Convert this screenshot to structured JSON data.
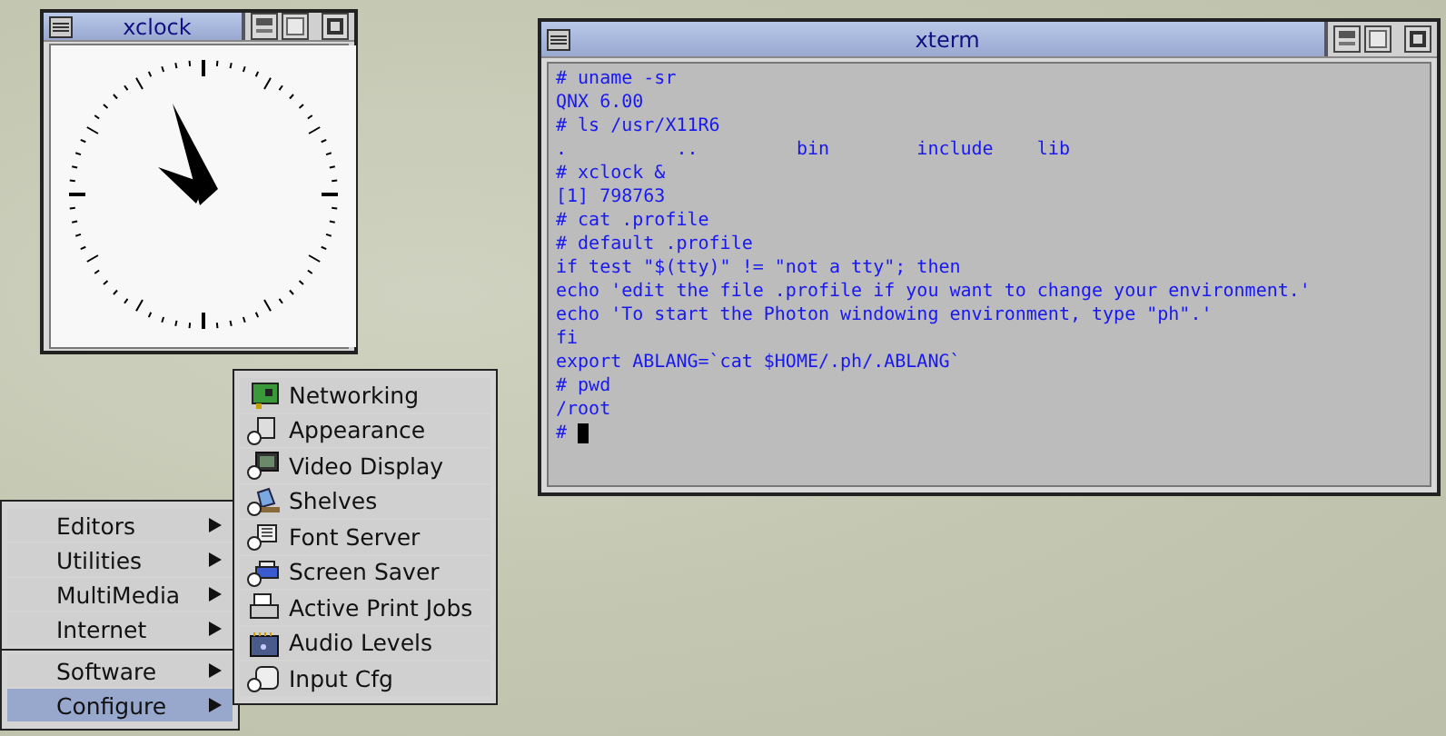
{
  "clock_window": {
    "title": "xclock"
  },
  "terminal_window": {
    "title": "xterm",
    "cursor": true,
    "lines": [
      "# uname -sr",
      "QNX 6.00",
      "# ls /usr/X11R6",
      ".          ..         bin        include    lib",
      "# xclock &",
      "[1] 798763",
      "# cat .profile",
      "# default .profile",
      "if test \"$(tty)\" != \"not a tty\"; then",
      "echo 'edit the file .profile if you want to change your environment.'",
      "echo 'To start the Photon windowing environment, type \"ph\".'",
      "fi",
      "export ABLANG=`cat $HOME/.ph/.ABLANG`",
      "# pwd",
      "/root",
      "# "
    ]
  },
  "menu": {
    "groups": [
      [
        {
          "label": "Editors",
          "submenu": true,
          "selected": false
        },
        {
          "label": "Utilities",
          "submenu": true,
          "selected": false
        },
        {
          "label": "MultiMedia",
          "submenu": true,
          "selected": false
        },
        {
          "label": "Internet",
          "submenu": true,
          "selected": false
        }
      ],
      [
        {
          "label": "Software",
          "submenu": true,
          "selected": false
        },
        {
          "label": "Configure",
          "submenu": true,
          "selected": true
        }
      ]
    ]
  },
  "submenu": {
    "items": [
      {
        "label": "Networking"
      },
      {
        "label": "Appearance"
      },
      {
        "label": "Video Display"
      },
      {
        "label": "Shelves"
      },
      {
        "label": "Font Server"
      },
      {
        "label": "Screen Saver"
      },
      {
        "label": "Active Print Jobs"
      },
      {
        "label": "Audio Levels"
      },
      {
        "label": "Input Cfg"
      }
    ]
  }
}
